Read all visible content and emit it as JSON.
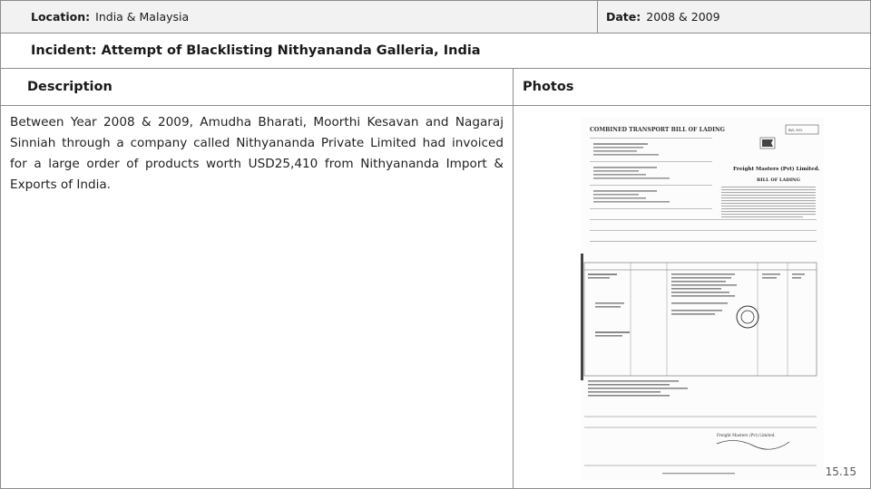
{
  "header": {
    "location_label": "Location:",
    "location_value": "India & Malaysia",
    "date_label": "Date:",
    "date_value": "2008 & 2009"
  },
  "incident": "Incident: Attempt of Blacklisting Nithyananda Galleria, India",
  "columns": {
    "description": "Description",
    "photos": "Photos"
  },
  "description_text": "Between Year 2008 & 2009, Amudha Bharati, Moorthi Kesavan and Nagaraj Sinniah through a company called Nithyananda Private Limited had invoiced for a large order of products worth USD25,410 from Nithyananda Import & Exports of India.",
  "document": {
    "heading": "COMBINED TRANSPORT BILL OF LADING",
    "company": "Freight Masters (Pvt) Limited.",
    "subheading": "BILL OF LADING",
    "bl_no": "B/L NO."
  },
  "page_number": "15.15"
}
